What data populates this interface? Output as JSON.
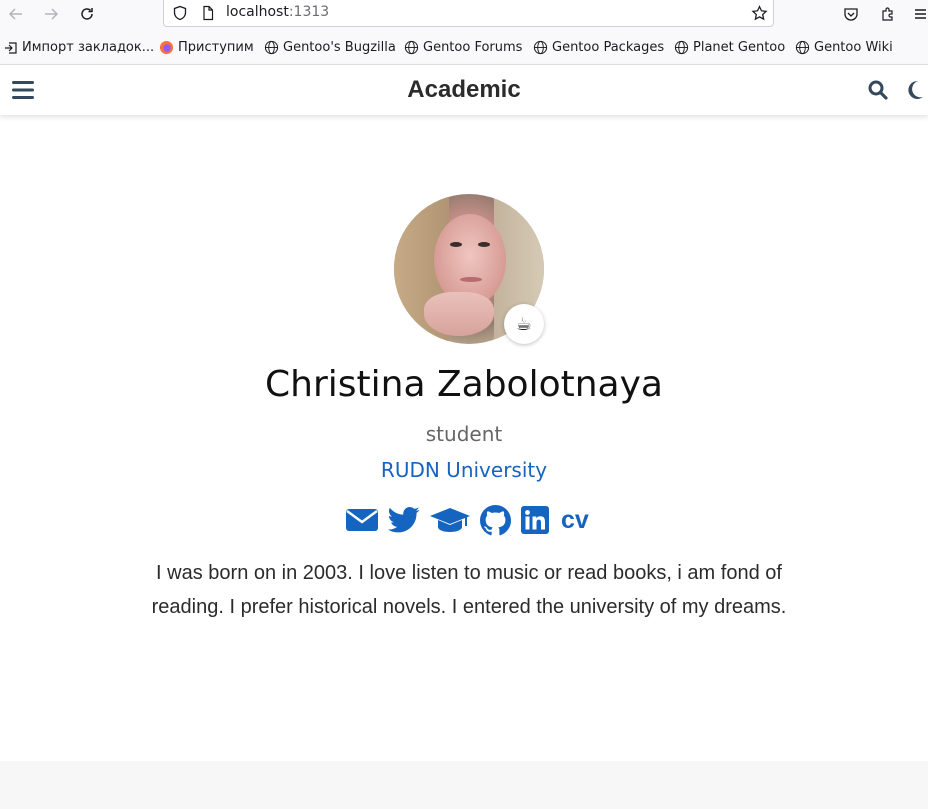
{
  "browser": {
    "url_host": "localhost",
    "url_port": ":1313",
    "bookmarks": [
      {
        "label": "Импорт закладок...",
        "icon": "import-icon"
      },
      {
        "label": "Приступим",
        "icon": "firefox-icon"
      },
      {
        "label": "Gentoo's Bugzilla",
        "icon": "globe-icon"
      },
      {
        "label": "Gentoo Forums",
        "icon": "globe-icon"
      },
      {
        "label": "Gentoo Packages",
        "icon": "globe-icon"
      },
      {
        "label": "Planet Gentoo",
        "icon": "globe-icon"
      },
      {
        "label": "Gentoo Wiki",
        "icon": "globe-icon"
      }
    ]
  },
  "site": {
    "brand": "Academic"
  },
  "profile": {
    "name": "Christina Zabolotnaya",
    "role": "student",
    "organization": "RUDN University",
    "status_emoji": "☕",
    "social": [
      {
        "name": "email",
        "icon": "envelope-icon"
      },
      {
        "name": "twitter",
        "icon": "twitter-icon"
      },
      {
        "name": "scholar",
        "icon": "graduation-cap-icon"
      },
      {
        "name": "github",
        "icon": "github-icon"
      },
      {
        "name": "linkedin",
        "icon": "linkedin-icon"
      },
      {
        "name": "cv",
        "label": "cv"
      }
    ],
    "bio": "I was born on in 2003. I love listen to music or read books, i am fond of reading. I prefer historical novels. I entered the university of my dreams."
  },
  "colors": {
    "link": "#1565c0",
    "brand_text": "#2b2b2b",
    "nav_icon": "#34495e"
  }
}
